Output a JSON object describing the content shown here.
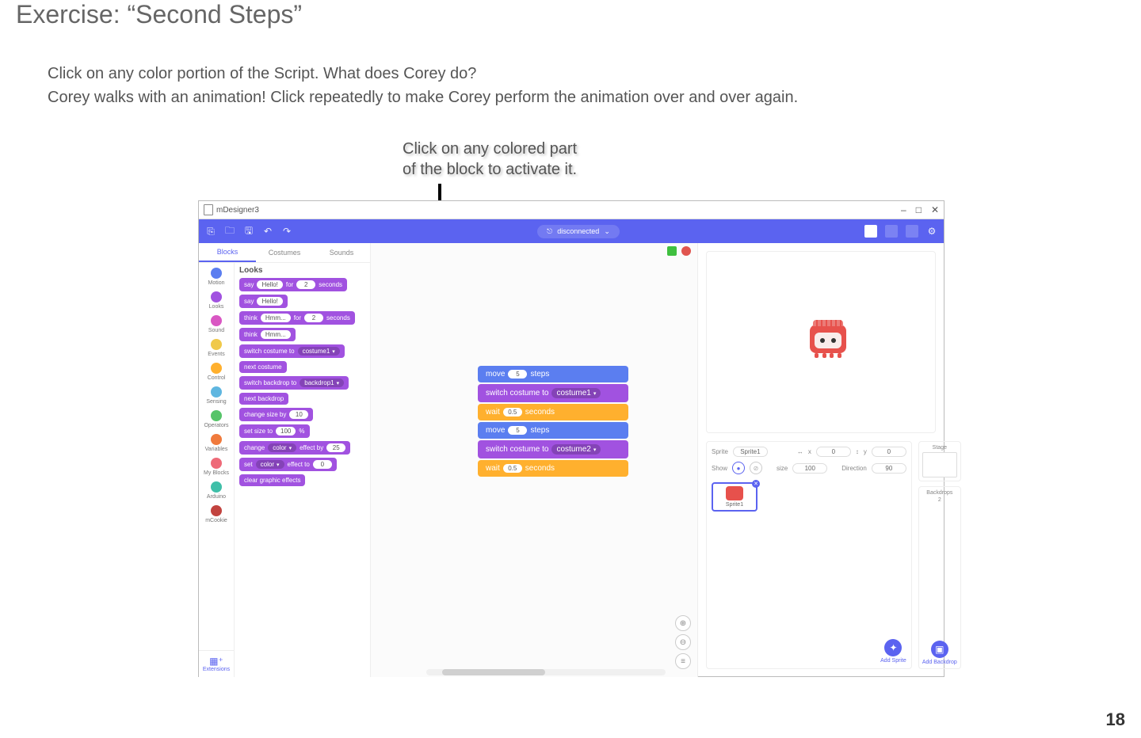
{
  "page": {
    "title": "Exercise: “Second Steps”",
    "number": "18",
    "instructions_line1": "Click on any color portion of the Script. What does Corey do?",
    "instructions_line2": "Corey walks with an animation! Click repeatedly to make Corey perform the animation over and over again.",
    "annotation_line1": "Click on any colored part",
    "annotation_line2": "of the block to activate it."
  },
  "app": {
    "window_title": "mDesigner3",
    "win_min": "–",
    "win_max": "□",
    "win_close": "✕",
    "connection_status": "disconnected",
    "conn_caret": "⌄",
    "sidebar_tabs": {
      "blocks": "Blocks",
      "costumes": "Costumes",
      "sounds": "Sounds"
    },
    "categories": {
      "motion": {
        "label": "Motion",
        "color": "#5b7ef0"
      },
      "looks": {
        "label": "Looks",
        "color": "#a152e0"
      },
      "sound": {
        "label": "Sound",
        "color": "#d957c3"
      },
      "events": {
        "label": "Events",
        "color": "#f0c94a"
      },
      "control": {
        "label": "Control",
        "color": "#ffb02e"
      },
      "sensing": {
        "label": "Sensing",
        "color": "#5fb6e0"
      },
      "operators": {
        "label": "Operators",
        "color": "#56c469"
      },
      "variables": {
        "label": "Variables",
        "color": "#f07a3c"
      },
      "myblocks": {
        "label": "My Blocks",
        "color": "#ee6a78"
      },
      "arduino": {
        "label": "Arduino",
        "color": "#3fbfa8"
      },
      "mcookie": {
        "label": "mCookie",
        "color": "#c2433f"
      }
    },
    "extensions_label": "Extensions",
    "palette": {
      "section": "Looks",
      "blocks": {
        "say_for": {
          "w1": "say",
          "v1": "Hello!",
          "w2": "for",
          "v2": "2",
          "w3": "seconds"
        },
        "say": {
          "w1": "say",
          "v1": "Hello!"
        },
        "think_for": {
          "w1": "think",
          "v1": "Hmm...",
          "w2": "for",
          "v2": "2",
          "w3": "seconds"
        },
        "think": {
          "w1": "think",
          "v1": "Hmm..."
        },
        "switch_costume": {
          "w1": "switch costume to",
          "v1": "costume1",
          "caret": "▾"
        },
        "next_costume": {
          "w1": "next costume"
        },
        "switch_backdrop": {
          "w1": "switch backdrop to",
          "v1": "backdrop1",
          "caret": "▾"
        },
        "next_backdrop": {
          "w1": "next backdrop"
        },
        "change_size": {
          "w1": "change size by",
          "v1": "10"
        },
        "set_size": {
          "w1": "set size to",
          "v1": "100",
          "w2": "%"
        },
        "change_effect": {
          "w1": "change",
          "v1": "color",
          "caret": "▾",
          "w2": "effect by",
          "v2": "25"
        },
        "set_effect": {
          "w1": "set",
          "v1": "color",
          "caret": "▾",
          "w2": "effect to",
          "v2": "0"
        },
        "clear_effects": {
          "w1": "clear graphic effects"
        }
      }
    },
    "script": {
      "move1": {
        "w1": "move",
        "v1": "5",
        "w2": "steps"
      },
      "switch1": {
        "w1": "switch costume to",
        "v1": "costume1",
        "caret": "▾"
      },
      "wait1": {
        "w1": "wait",
        "v1": "0.5",
        "w2": "seconds"
      },
      "move2": {
        "w1": "move",
        "v1": "5",
        "w2": "steps"
      },
      "switch2": {
        "w1": "switch costume to",
        "v1": "costume2",
        "caret": "▾"
      },
      "wait2": {
        "w1": "wait",
        "v1": "0.5",
        "w2": "seconds"
      }
    },
    "zoom": {
      "in": "⊕",
      "out": "⊖",
      "reset": "≡"
    },
    "sprite_panel": {
      "sprite_label": "Sprite",
      "sprite_name": "Sprite1",
      "x_label": "x",
      "x_value": "0",
      "y_label": "y",
      "y_value": "0",
      "show_label": "Show",
      "size_label": "size",
      "size_value": "100",
      "direction_label": "Direction",
      "direction_value": "90",
      "thumb_label": "Sprite1",
      "add_sprite": "Add Sprite"
    },
    "stage_panel": {
      "stage_label": "Stage",
      "backdrops_label": "Backdrops",
      "backdrops_count": "2",
      "add_backdrop": "Add Backdrop"
    }
  }
}
